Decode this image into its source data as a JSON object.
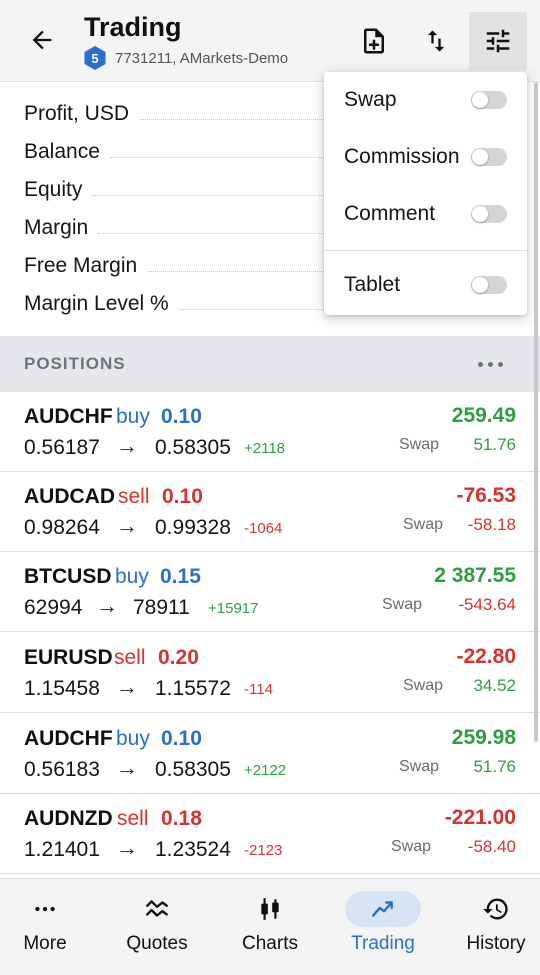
{
  "header": {
    "title": "Trading",
    "account_number": "5",
    "account_text": "7731211, AMarkets-Demo",
    "icons": [
      "back-arrow-icon",
      "new-order-icon",
      "sort-icon",
      "settings-sliders-icon"
    ]
  },
  "summary": {
    "rows": [
      {
        "label": "Profit, USD"
      },
      {
        "label": "Balance"
      },
      {
        "label": "Equity"
      },
      {
        "label": "Margin"
      },
      {
        "label": "Free Margin"
      },
      {
        "label": "Margin Level %"
      }
    ]
  },
  "positions": {
    "title": "POSITIONS",
    "swap_label": "Swap",
    "items": [
      {
        "symbol": "AUDCHF",
        "side": "buy",
        "volume": "0.10",
        "profit": "259.49",
        "open": "0.56187",
        "arrow": "→",
        "current": "0.58305",
        "points": "+2118",
        "swap": "51.76"
      },
      {
        "symbol": "AUDCAD",
        "side": "sell",
        "volume": "0.10",
        "profit": "-76.53",
        "open": "0.98264",
        "arrow": "→",
        "current": "0.99328",
        "points": "-1064",
        "swap": "-58.18"
      },
      {
        "symbol": "BTCUSD",
        "side": "buy",
        "volume": "0.15",
        "profit": "2 387.55",
        "open": "62994",
        "arrow": "→",
        "current": "78911",
        "points": "+15917",
        "swap": "-543.64"
      },
      {
        "symbol": "EURUSD",
        "side": "sell",
        "volume": "0.20",
        "profit": "-22.80",
        "open": "1.15458",
        "arrow": "→",
        "current": "1.15572",
        "points": "-114",
        "swap": "34.52"
      },
      {
        "symbol": "AUDCHF",
        "side": "buy",
        "volume": "0.10",
        "profit": "259.98",
        "open": "0.56183",
        "arrow": "→",
        "current": "0.58305",
        "points": "+2122",
        "swap": "51.76"
      },
      {
        "symbol": "AUDNZD",
        "side": "sell",
        "volume": "0.18",
        "profit": "-221.00",
        "open": "1.21401",
        "arrow": "→",
        "current": "1.23524",
        "points": "-2123",
        "swap": "-58.40"
      }
    ]
  },
  "menu": {
    "items": [
      {
        "label": "Swap",
        "checked": false
      },
      {
        "label": "Commission",
        "checked": false
      },
      {
        "label": "Comment",
        "checked": false
      },
      {
        "label": "Tablet",
        "checked": false
      }
    ]
  },
  "nav": {
    "items": [
      {
        "label": "More",
        "icon": "more-dots-icon"
      },
      {
        "label": "Quotes",
        "icon": "quotes-icon"
      },
      {
        "label": "Charts",
        "icon": "candlestick-icon"
      },
      {
        "label": "Trading",
        "icon": "trend-line-icon"
      },
      {
        "label": "History",
        "icon": "history-icon"
      }
    ],
    "active": "Trading"
  },
  "colors": {
    "buy": "#2a6dd3",
    "sell": "#d6322f",
    "profit_positive": "#2e9e43",
    "profit_negative": "#d6322f",
    "active_accent": "#2a6dd3"
  }
}
